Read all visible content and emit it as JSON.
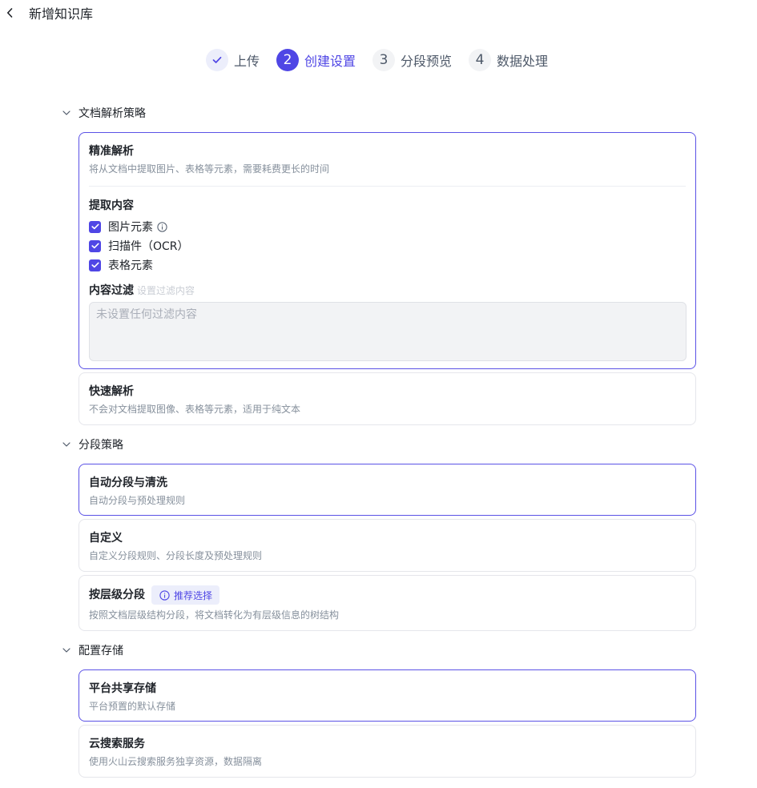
{
  "header": {
    "title": "新增知识库"
  },
  "steps": [
    {
      "number": "",
      "label": "上传",
      "status": "done"
    },
    {
      "number": "2",
      "label": "创建设置",
      "status": "active"
    },
    {
      "number": "3",
      "label": "分段预览",
      "status": "todo"
    },
    {
      "number": "4",
      "label": "数据处理",
      "status": "todo"
    }
  ],
  "parse_section": {
    "title": "文档解析策略",
    "precise": {
      "title": "精准解析",
      "desc": "将从文档中提取图片、表格等元素，需要耗费更长的时间",
      "extract_title": "提取内容",
      "options": [
        {
          "label": "图片元素",
          "checked": true
        },
        {
          "label": "扫描件（OCR）",
          "checked": true
        },
        {
          "label": "表格元素",
          "checked": true
        }
      ],
      "filter_title": "内容过滤",
      "filter_hint": "设置过滤内容",
      "filter_placeholder": "未设置任何过滤内容"
    },
    "fast": {
      "title": "快速解析",
      "desc": "不会对文档提取图像、表格等元素，适用于纯文本"
    }
  },
  "segment_section": {
    "title": "分段策略",
    "auto": {
      "title": "自动分段与清洗",
      "desc": "自动分段与预处理规则"
    },
    "custom": {
      "title": "自定义",
      "desc": "自定义分段规则、分段长度及预处理规则"
    },
    "hierarchy": {
      "title": "按层级分段",
      "badge": "推荐选择",
      "desc": "按照文档层级结构分段，将文档转化为有层级信息的树结构"
    }
  },
  "storage_section": {
    "title": "配置存储",
    "platform": {
      "title": "平台共享存储",
      "desc": "平台预置的默认存储"
    },
    "cloud": {
      "title": "云搜索服务",
      "desc": "使用火山云搜索服务独享资源，数据隔离"
    }
  },
  "colors": {
    "accent": "#4f46e5",
    "border_selected": "#5b52e6",
    "border": "#e5e6eb"
  }
}
